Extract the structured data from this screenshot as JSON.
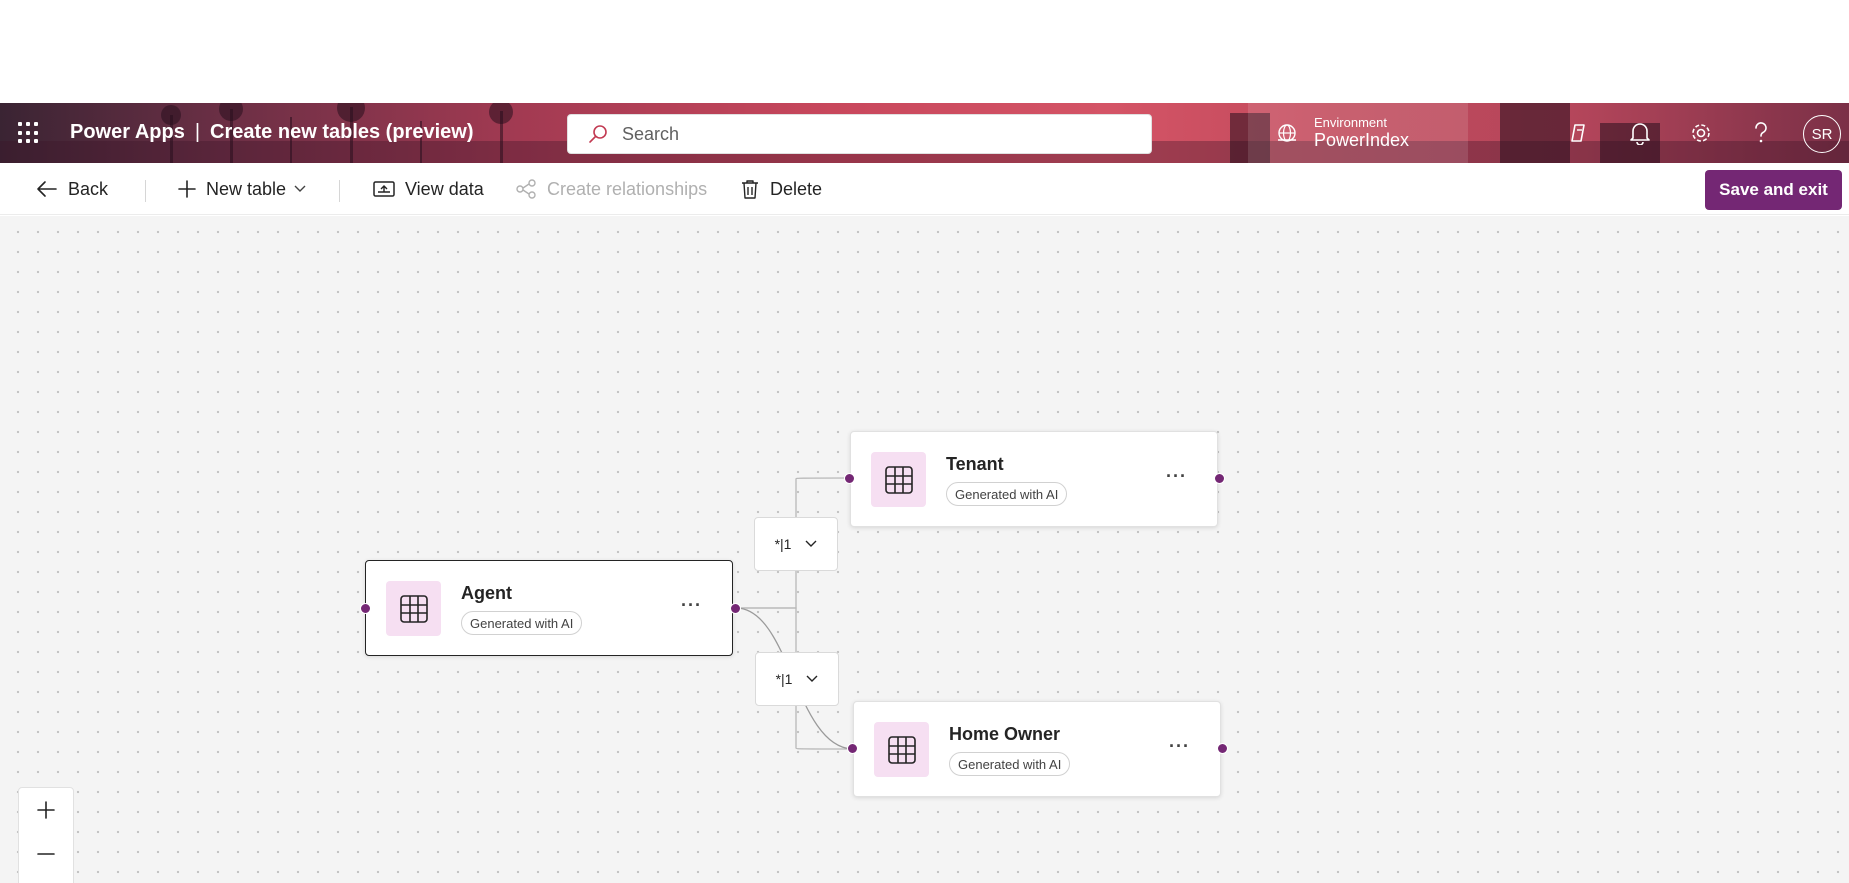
{
  "header": {
    "app_name": "Power Apps",
    "separator": "|",
    "page_title": "Create new tables (preview)",
    "search_placeholder": "Search",
    "environment_label": "Environment",
    "environment_name": "PowerIndex",
    "avatar_initials": "SR",
    "icons": [
      "waffle-icon",
      "copilot-icon",
      "bell-icon",
      "gear-icon",
      "help-icon"
    ]
  },
  "toolbar": {
    "back_label": "Back",
    "new_table_label": "New table",
    "view_data_label": "View data",
    "create_relationships_label": "Create relationships",
    "delete_label": "Delete",
    "save_label": "Save and exit"
  },
  "tables": [
    {
      "name": "Agent",
      "badge": "Generated with AI",
      "selected": true
    },
    {
      "name": "Tenant",
      "badge": "Generated with AI",
      "selected": false
    },
    {
      "name": "Home Owner",
      "badge": "Generated with AI",
      "selected": false
    }
  ],
  "relationships": [
    {
      "label": "*|1",
      "from": "Agent",
      "to": "Tenant"
    },
    {
      "label": "*|1",
      "from": "Agent",
      "to": "Home Owner"
    }
  ],
  "colors": {
    "accent": "#742774",
    "tile_bg": "#f6dff2",
    "canvas_bg": "#f4f4f4"
  }
}
